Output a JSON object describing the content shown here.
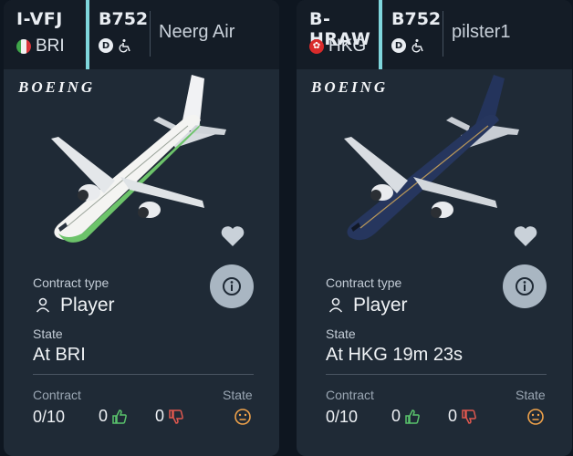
{
  "colors": {
    "background": "#0e1620",
    "card": "#1f2a36",
    "header": "#141c26",
    "accent": "#7fd6dc",
    "like": "#59c26b",
    "dislike": "#e0584f",
    "neutral_face": "#f0a24a"
  },
  "cards": [
    {
      "registration": "I-VFJ",
      "airport": "BRI",
      "flag": "italy",
      "aircraft_type": "B752",
      "owner": "Neerg Air",
      "brand": "BOEING",
      "favorite_icon": "heart-icon",
      "contract_type_label": "Contract type",
      "contract_type_value": "Player",
      "state_label": "State",
      "state_value": "At BRI",
      "footer": {
        "contract_label": "Contract",
        "contract_value": "0/10",
        "likes": "0",
        "dislikes": "0",
        "state_label": "State"
      },
      "livery": "green"
    },
    {
      "registration": "B-HRAW",
      "airport": "HKG",
      "flag": "hong-kong",
      "aircraft_type": "B752",
      "owner": "pilster1",
      "brand": "BOEING",
      "favorite_icon": "heart-icon",
      "contract_type_label": "Contract type",
      "contract_type_value": "Player",
      "state_label": "State",
      "state_value": "At HKG 19m 23s",
      "footer": {
        "contract_label": "Contract",
        "contract_value": "0/10",
        "likes": "0",
        "dislikes": "0",
        "state_label": "State"
      },
      "livery": "navy"
    }
  ]
}
